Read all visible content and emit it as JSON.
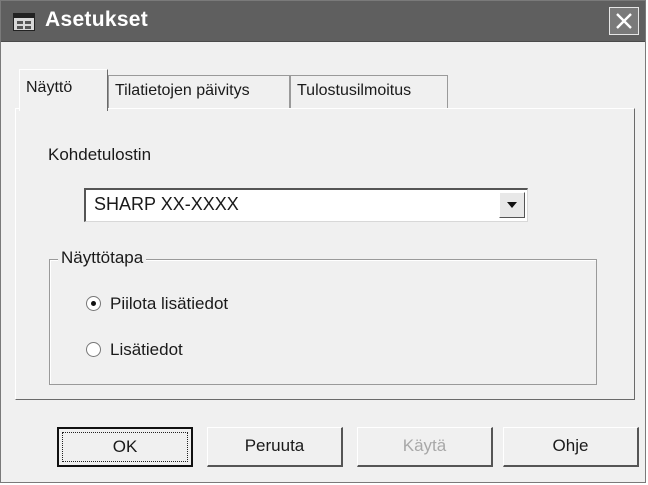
{
  "window": {
    "title": "Asetukset"
  },
  "tabs": [
    {
      "label": "Näyttö"
    },
    {
      "label": "Tilatietojen päivitys"
    },
    {
      "label": "Tulostusilmoitus"
    }
  ],
  "printer": {
    "label": "Kohdetulostin",
    "selected": "SHARP XX-XXXX"
  },
  "display_mode": {
    "title": "Näyttötapa",
    "options": [
      {
        "label": "Piilota lisätiedot",
        "selected": true
      },
      {
        "label": "Lisätiedot",
        "selected": false
      }
    ]
  },
  "buttons": {
    "ok": "OK",
    "cancel": "Peruuta",
    "apply": "Käytä",
    "help": "Ohje"
  },
  "icons": {
    "title": "settings-window-icon",
    "close": "close-icon",
    "dropdown": "chevron-down-icon"
  }
}
